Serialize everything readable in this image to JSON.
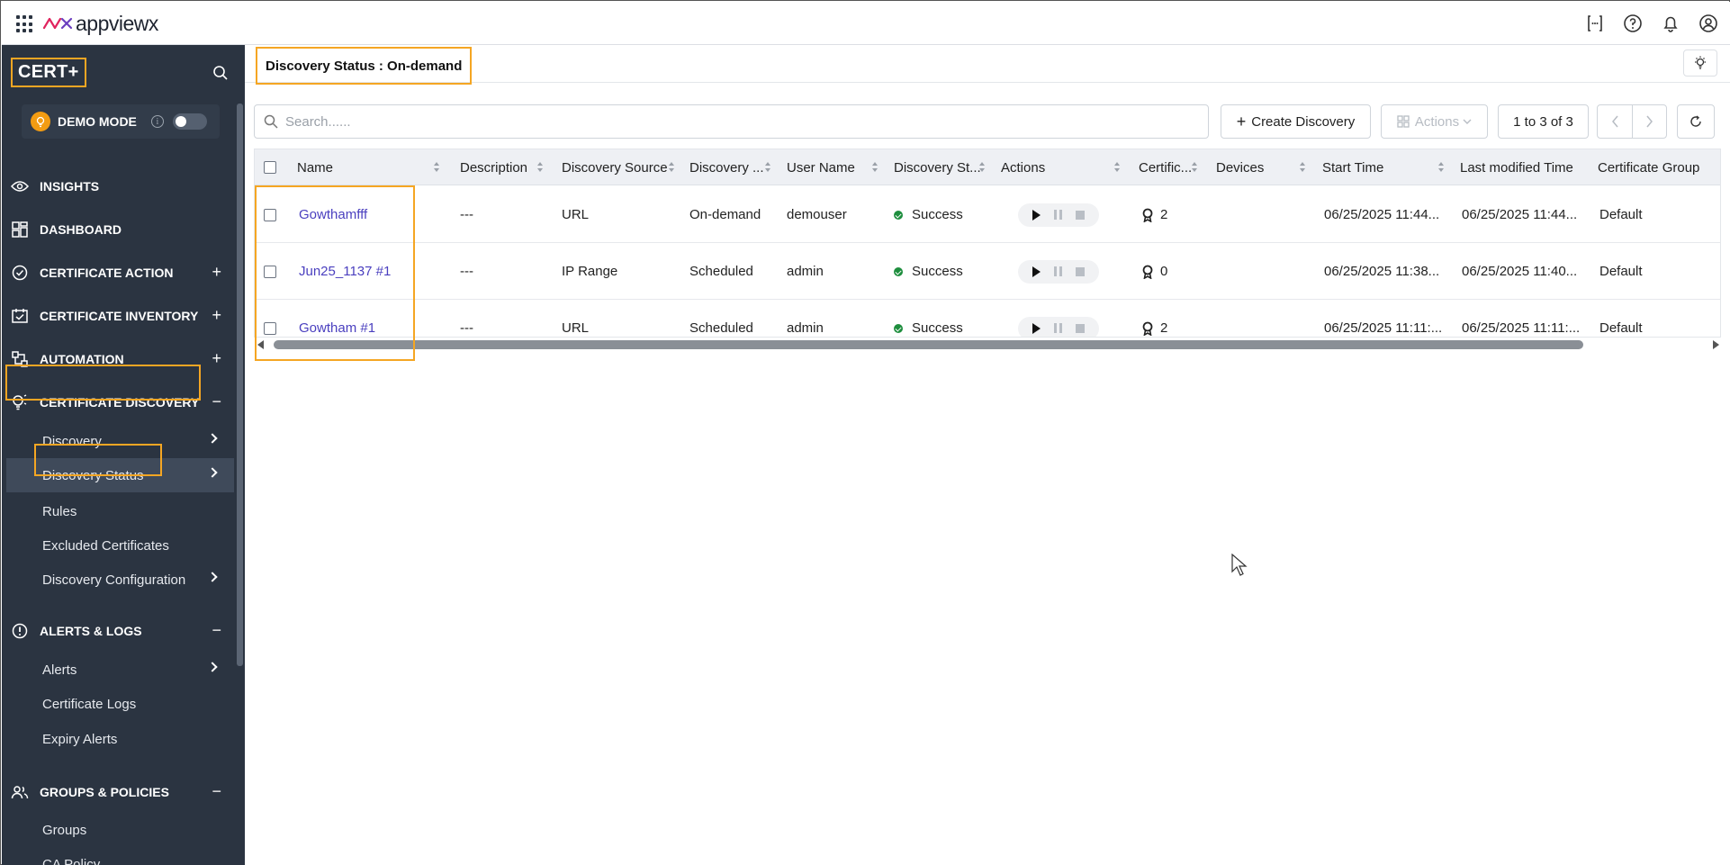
{
  "app": {
    "logo_text": "appviewx",
    "brand": "CERT+"
  },
  "topbar": {
    "icons": [
      "api-icon",
      "help-icon",
      "bell-icon",
      "user-icon"
    ]
  },
  "sidebar": {
    "demo_mode": {
      "label": "DEMO MODE",
      "info": "i",
      "enabled": false
    },
    "sections": [
      {
        "label": "INSIGHTS",
        "icon": "eye-icon"
      },
      {
        "label": "DASHBOARD",
        "icon": "dashboard-icon"
      },
      {
        "label": "CERTIFICATE ACTION",
        "icon": "check-circle-icon",
        "toggle": "+"
      },
      {
        "label": "CERTIFICATE INVENTORY",
        "icon": "inventory-icon",
        "toggle": "+"
      },
      {
        "label": "AUTOMATION",
        "icon": "automation-icon",
        "toggle": "+"
      },
      {
        "label": "CERTIFICATE DISCOVERY",
        "icon": "discovery-bulb-icon",
        "toggle": "−"
      },
      {
        "label": "ALERTS & LOGS",
        "icon": "alert-icon",
        "toggle": "−"
      },
      {
        "label": "GROUPS & POLICIES",
        "icon": "groups-icon",
        "toggle": "−"
      }
    ],
    "discovery_items": [
      "Discovery",
      "Discovery Status",
      "Rules",
      "Excluded Certificates",
      "Discovery Configuration"
    ],
    "alerts_items": [
      "Alerts",
      "Certificate Logs",
      "Expiry Alerts"
    ],
    "groups_items": [
      "Groups",
      "CA Policy"
    ]
  },
  "main": {
    "title": "Discovery Status : On-demand",
    "search_placeholder": "Search......",
    "create_label": "Create Discovery",
    "actions_label": "Actions",
    "pagination": "1 to 3 of 3"
  },
  "table": {
    "columns": [
      "Name",
      "Description",
      "Discovery Source",
      "Discovery ...",
      "User Name",
      "Discovery St...",
      "Actions",
      "Certific...",
      "Devices",
      "Start Time",
      "Last modified Time",
      "Certificate Group"
    ],
    "rows": [
      {
        "name": "Gowthamfff",
        "description": "---",
        "source": "URL",
        "type": "On-demand",
        "user": "demouser",
        "status": "Success",
        "certs": "2",
        "devices": "",
        "start": "06/25/2025 11:44...",
        "modified": "06/25/2025 11:44...",
        "group": "Default"
      },
      {
        "name": "Jun25_1137 #1",
        "description": "---",
        "source": "IP Range",
        "type": "Scheduled",
        "user": "admin",
        "status": "Success",
        "certs": "0",
        "devices": "",
        "start": "06/25/2025 11:38...",
        "modified": "06/25/2025 11:40...",
        "group": "Default"
      },
      {
        "name": "Gowtham #1",
        "description": "---",
        "source": "URL",
        "type": "Scheduled",
        "user": "admin",
        "status": "Success",
        "certs": "2",
        "devices": "",
        "start": "06/25/2025 11:11:...",
        "modified": "06/25/2025 11:11:...",
        "group": "Default"
      }
    ]
  },
  "colors": {
    "sidebar_bg": "#2b3441",
    "highlight": "#f5a623",
    "link": "#4a3fbf",
    "success": "#1e8e3e"
  }
}
